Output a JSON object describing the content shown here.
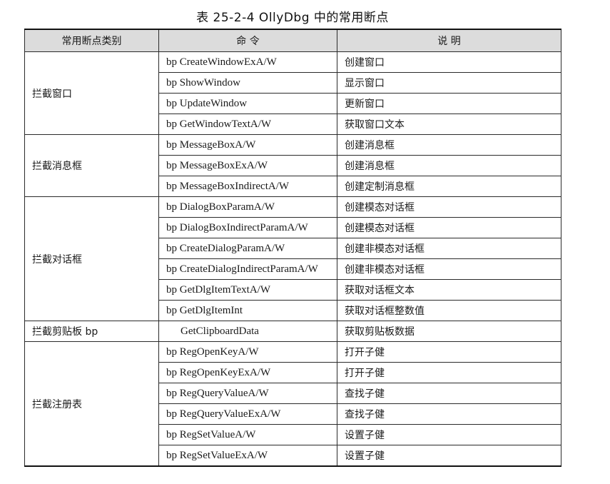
{
  "caption": "表 25-2-4    OllyDbg 中的常用断点",
  "table": {
    "headers": [
      "常用断点类别",
      "命    令",
      "说        明"
    ],
    "groups": [
      {
        "category": "拦截窗口",
        "rows": [
          {
            "command": "bp CreateWindowExA/W",
            "description": "创建窗口"
          },
          {
            "command": "bp ShowWindow",
            "description": "显示窗口"
          },
          {
            "command": "bp UpdateWindow",
            "description": "更新窗口"
          },
          {
            "command": "bp GetWindowTextA/W",
            "description": "获取窗口文本"
          }
        ]
      },
      {
        "category": "拦截消息框",
        "rows": [
          {
            "command": "bp MessageBoxA/W",
            "description": "创建消息框"
          },
          {
            "command": "bp MessageBoxExA/W",
            "description": "创建消息框"
          },
          {
            "command": "bp MessageBoxIndirectA/W",
            "description": "创建定制消息框"
          }
        ]
      },
      {
        "category": "拦截对话框",
        "rows": [
          {
            "command": "bp DialogBoxParamA/W",
            "description": "创建模态对话框"
          },
          {
            "command": "bp DialogBoxIndirectParamA/W",
            "description": "创建模态对话框"
          },
          {
            "command": "bp CreateDialogParamA/W",
            "description": "创建非模态对话框"
          },
          {
            "command": "bp CreateDialogIndirectParamA/W",
            "description": "创建非模态对话框"
          },
          {
            "command": "bp GetDlgItemTextA/W",
            "description": "获取对话框文本"
          },
          {
            "command": "bp GetDlgItemInt",
            "description": "获取对话框整数值"
          }
        ]
      },
      {
        "category": "拦截剪贴板 bp",
        "rows": [
          {
            "command": "GetClipboardData",
            "description": "获取剪贴板数据"
          }
        ]
      },
      {
        "category": "拦截注册表",
        "rows": [
          {
            "command": "bp RegOpenKeyA/W",
            "description": "打开子健"
          },
          {
            "command": "bp RegOpenKeyExA/W",
            "description": "打开子健"
          },
          {
            "command": "bp RegQueryValueA/W",
            "description": "查找子健"
          },
          {
            "command": "bp RegQueryValueExA/W",
            "description": "查找子健"
          },
          {
            "command": "bp RegSetValueA/W",
            "description": "设置子健"
          },
          {
            "command": "bp RegSetValueExA/W",
            "description": "设置子健"
          }
        ]
      }
    ]
  }
}
